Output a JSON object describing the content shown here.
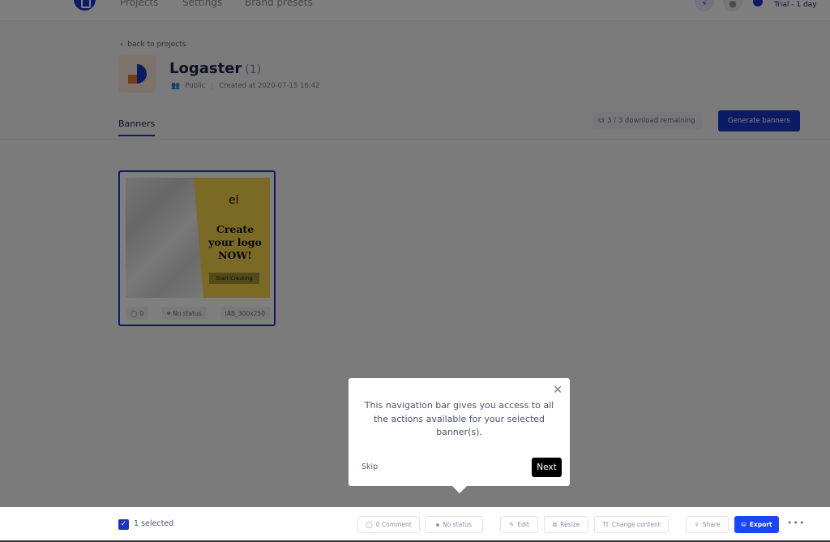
{
  "header": {
    "nav": [
      "Projects",
      "Settings",
      "Brand presets"
    ],
    "trial_label": "Trial - 1 day",
    "icons": [
      "bolt-icon",
      "chat-icon",
      "avatar"
    ]
  },
  "project": {
    "back_label": "back to projects",
    "title": "Logaster",
    "count": "(1)",
    "visibility": "Public",
    "created": "Created at 2020-07-15 16:42"
  },
  "tabs": {
    "banners": "Banners"
  },
  "downloads": {
    "label": "3 / 3 download remaining"
  },
  "generate_button": "Generate banners",
  "banner_card": {
    "preview": {
      "logo_text": "el",
      "headline": "Create your logo NOW!",
      "cta": "Start Creating"
    },
    "comments": "0",
    "status": "No status",
    "size": "IAB_300x250"
  },
  "tooltip": {
    "text": "This navigation bar gives you access to all the actions available for your selected banner(s).",
    "skip": "Skip",
    "next": "Next"
  },
  "bottombar": {
    "selected": "1 selected",
    "comment": "0 Comment",
    "status": "No status",
    "edit": "Edit",
    "resize": "Resize",
    "change_content": "Change content",
    "share": "Share",
    "export": "Export",
    "more": "•••"
  },
  "colors": {
    "accent": "#1a34c9",
    "export": "#1a44ff",
    "banner_yellow": "#f5d54b"
  }
}
